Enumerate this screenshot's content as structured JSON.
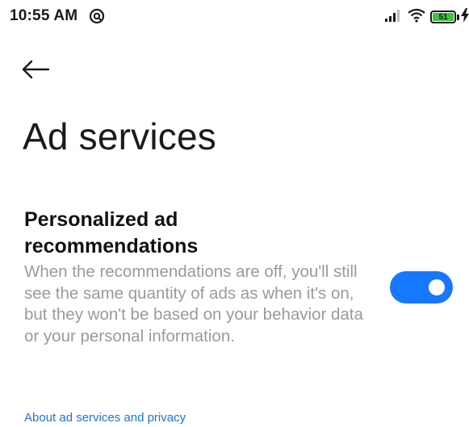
{
  "status_bar": {
    "time": "10:55 AM",
    "left_icons": [
      "vpn-key-icon"
    ],
    "right_icons": [
      "cellular-signal-icon",
      "wifi-icon",
      "battery-icon",
      "charging-bolt-icon"
    ],
    "battery_level": "51",
    "battery_color": "#3bc43b"
  },
  "header": {
    "back_icon": "arrow-left-icon",
    "title": "Ad services"
  },
  "setting": {
    "title": "Personalized ad recommendations",
    "description": "When the recommendations are off, you'll still see the same quantity of ads as when it's on, but they won't be based on your behavior data or your personal information.",
    "toggle_state": "on",
    "toggle_color": "#1677ff"
  },
  "footer": {
    "link_label": "About ad services and privacy",
    "link_color": "#1a73e8"
  }
}
